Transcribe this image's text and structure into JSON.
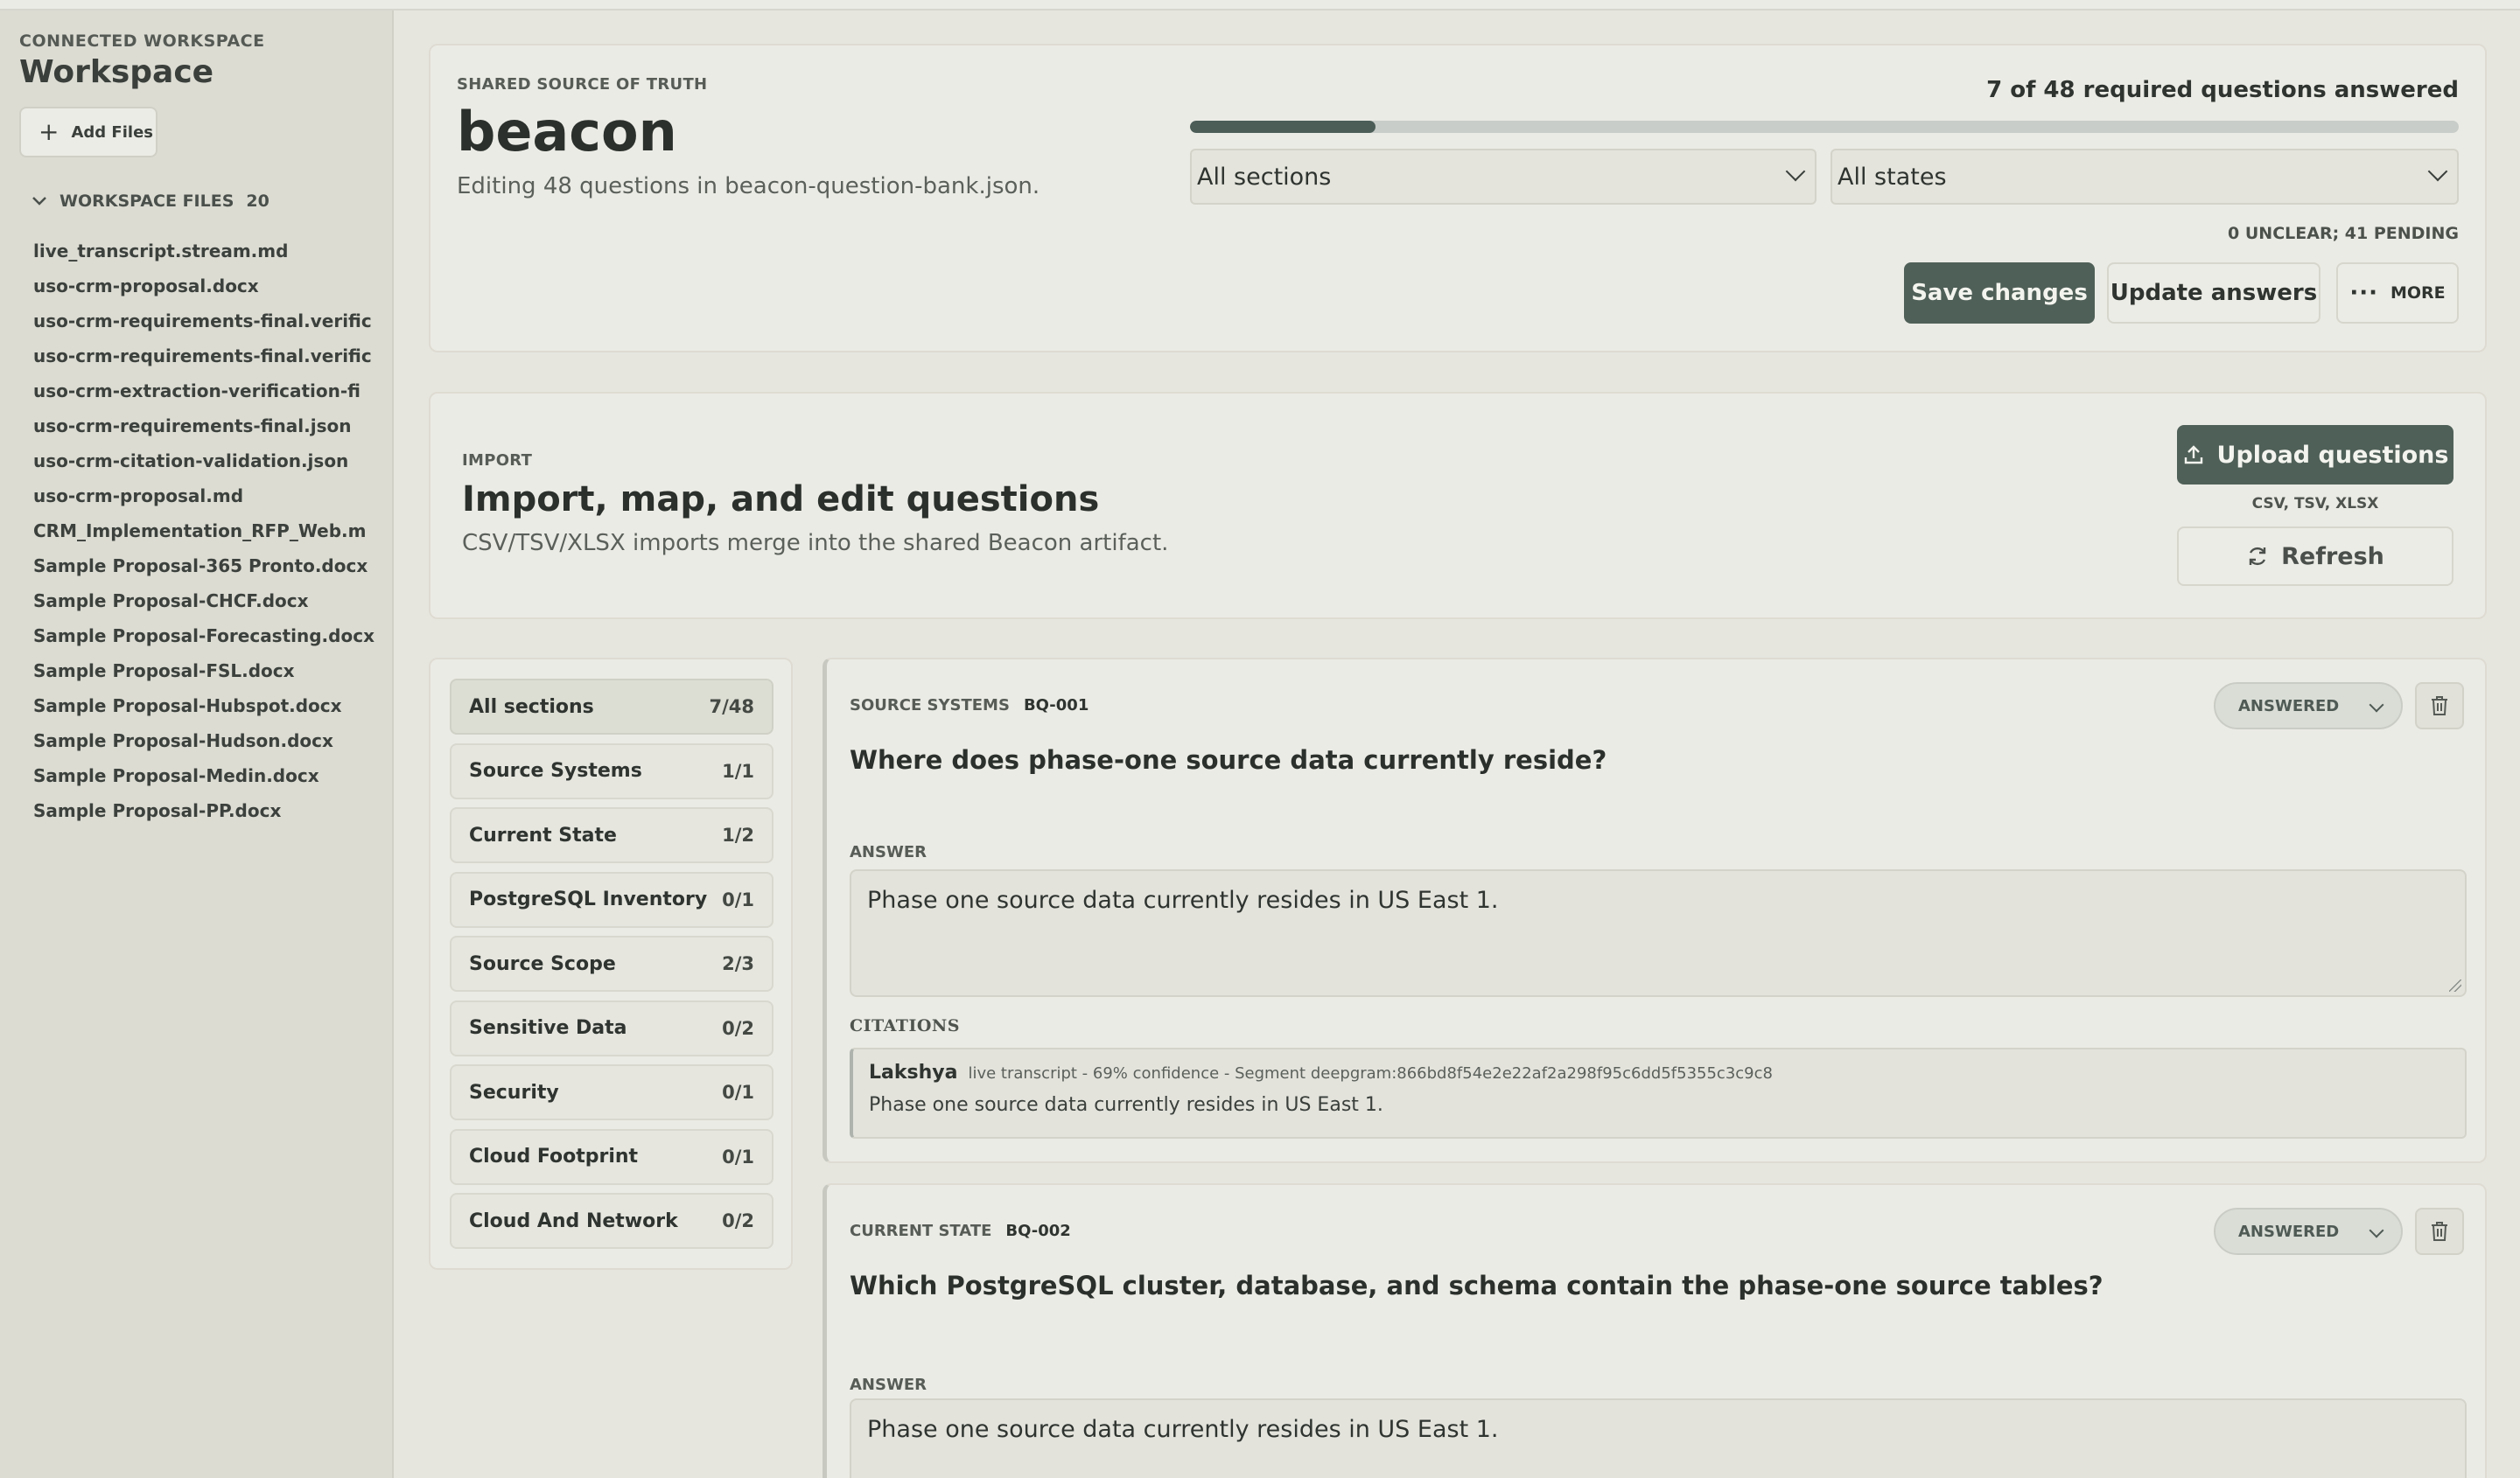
{
  "sidebar": {
    "eyebrow": "CONNECTED WORKSPACE",
    "title": "Workspace",
    "add_files_label": "Add Files",
    "files_header": "WORKSPACE FILES",
    "files_count": "20",
    "files": [
      "live_transcript.stream.md",
      "uso-crm-proposal.docx",
      "uso-crm-requirements-final.verific",
      "uso-crm-requirements-final.verific",
      "uso-crm-extraction-verification-fi",
      "uso-crm-requirements-final.json",
      "uso-crm-citation-validation.json",
      "uso-crm-proposal.md",
      "CRM_Implementation_RFP_Web.m",
      "Sample Proposal-365 Pronto.docx",
      "Sample Proposal-CHCF.docx",
      "Sample Proposal-Forecasting.docx",
      "Sample Proposal-FSL.docx",
      "Sample Proposal-Hubspot.docx",
      "Sample Proposal-Hudson.docx",
      "Sample Proposal-Medin.docx",
      "Sample Proposal-PP.docx"
    ]
  },
  "header": {
    "eyebrow": "SHARED SOURCE OF TRUTH",
    "title": "beacon",
    "subtitle": "Editing 48 questions in beacon-question-bank.json.",
    "progress_label": "7 of 48 required questions answered",
    "progress_fraction": 0.146,
    "sections_select": "All sections",
    "states_select": "All states",
    "counts": "0 UNCLEAR; 41 PENDING",
    "save_label": "Save changes",
    "update_label": "Update answers",
    "more_label": "MORE"
  },
  "import": {
    "eyebrow": "IMPORT",
    "title": "Import, map, and edit questions",
    "subtitle": "CSV/TSV/XLSX imports merge into the shared Beacon artifact.",
    "upload_label": "Upload questions",
    "formats": "CSV, TSV, XLSX",
    "refresh_label": "Refresh"
  },
  "sections": [
    {
      "label": "All sections",
      "count": "7/48"
    },
    {
      "label": "Source Systems",
      "count": "1/1"
    },
    {
      "label": "Current State",
      "count": "1/2"
    },
    {
      "label": "PostgreSQL Inventory",
      "count": "0/1"
    },
    {
      "label": "Source Scope",
      "count": "2/3"
    },
    {
      "label": "Sensitive Data",
      "count": "0/2"
    },
    {
      "label": "Security",
      "count": "0/1"
    },
    {
      "label": "Cloud Footprint",
      "count": "0/1"
    },
    {
      "label": "Cloud And Network",
      "count": "0/2"
    }
  ],
  "questions": [
    {
      "section": "SOURCE SYSTEMS",
      "id": "BQ-001",
      "status": "ANSWERED",
      "title": "Where does phase-one source data currently reside?",
      "answer_label": "ANSWER",
      "answer": "Phase one source data currently resides in US East 1.",
      "citations_label": "CITATIONS",
      "citation": {
        "author": "Lakshya",
        "meta": "live transcript - 69% confidence - Segment deepgram:866bd8f54e2e22af2a298f95c6dd5f5355c3c9c8",
        "text": "Phase one source data currently resides in US East 1."
      }
    },
    {
      "section": "CURRENT STATE",
      "id": "BQ-002",
      "status": "ANSWERED",
      "title": "Which PostgreSQL cluster, database, and schema contain the phase-one source tables?",
      "answer_label": "ANSWER",
      "answer": "Phase one source data currently resides in US East 1."
    }
  ],
  "colors": {
    "accent": "#4f6058",
    "background": "#e6e6df",
    "card": "#ebebe5"
  }
}
